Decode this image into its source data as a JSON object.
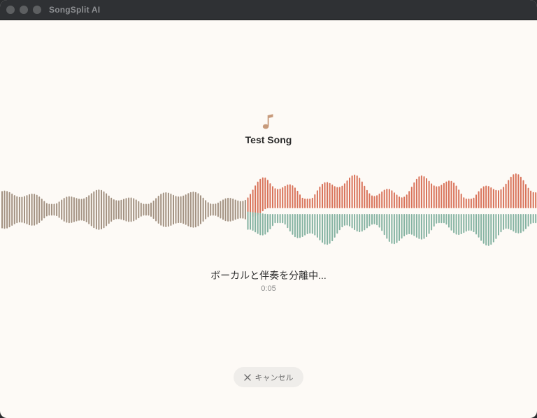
{
  "window": {
    "title": "SongSplit AI"
  },
  "song": {
    "title": "Test Song",
    "icon": "music-note-icon"
  },
  "progress": {
    "status": "ボーカルと伴奏を分離中...",
    "elapsed": "0:05"
  },
  "actions": {
    "cancel_label": "キャンセル",
    "cancel_icon": "close-icon"
  },
  "colors": {
    "background": "#fdfaf6",
    "original_wave": "#a39282",
    "vocal_wave": "#d9735a",
    "accompaniment_wave": "#85b3a2",
    "icon": "#c79a7b"
  }
}
